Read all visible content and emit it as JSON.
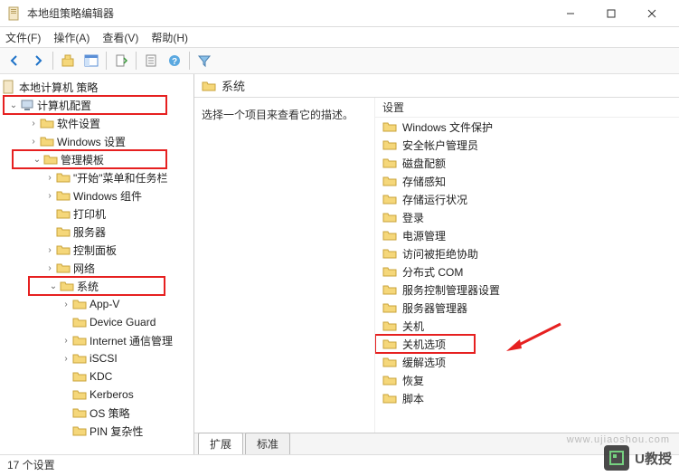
{
  "window": {
    "title": "本地组策略编辑器"
  },
  "menu": {
    "file": "文件(F)",
    "action": "操作(A)",
    "view": "查看(V)",
    "help": "帮助(H)"
  },
  "tree": {
    "root": "本地计算机 策略",
    "computerConfig": "计算机配置",
    "softwareSettings": "软件设置",
    "windowsSettings": "Windows 设置",
    "adminTemplates": "管理模板",
    "startMenuTaskbar": "\"开始\"菜单和任务栏",
    "windowsComponents": "Windows 组件",
    "printers": "打印机",
    "servers": "服务器",
    "controlPanel": "控制面板",
    "network": "网络",
    "system": "系统",
    "appv": "App-V",
    "deviceGuard": "Device Guard",
    "internetComm": "Internet 通信管理",
    "iscsi": "iSCSI",
    "kdc": "KDC",
    "kerberos": "Kerberos",
    "osPolicy": "OS 策略",
    "pinComplexity": "PIN 复杂性"
  },
  "content": {
    "header": "系统",
    "description": "选择一个项目来查看它的描述。",
    "settingsLabel": "设置",
    "items": [
      "Windows 文件保护",
      "安全帐户管理员",
      "磁盘配额",
      "存储感知",
      "存储运行状况",
      "登录",
      "电源管理",
      "访问被拒绝协助",
      "分布式 COM",
      "服务控制管理器设置",
      "服务器管理器",
      "关机",
      "关机选项",
      "缓解选项",
      "恢复",
      "脚本"
    ],
    "highlightItem": "关机选项"
  },
  "tabs": {
    "extended": "扩展",
    "standard": "标准"
  },
  "status": "17 个设置",
  "watermark": {
    "text": "U教授",
    "url": "www.ujiaoshou.com"
  }
}
